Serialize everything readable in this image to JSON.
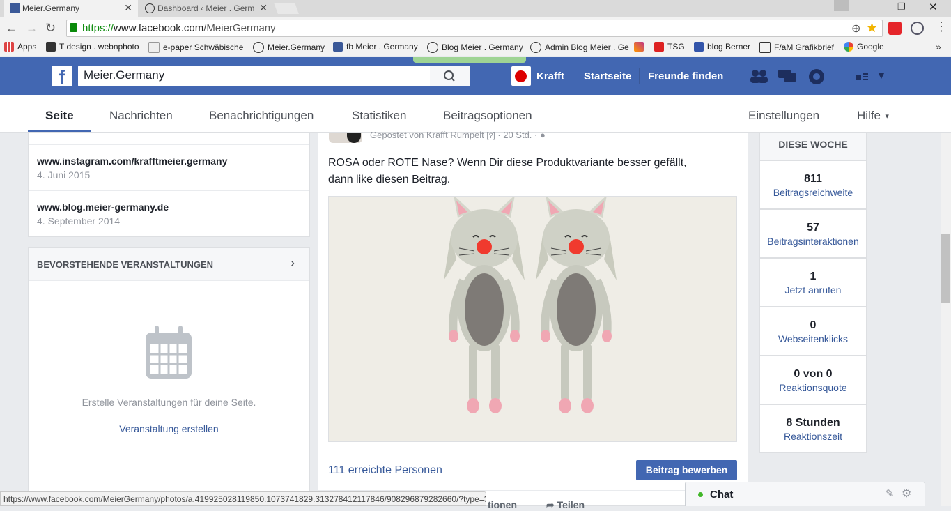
{
  "browser": {
    "tabs": [
      {
        "title": "Meier.Germany",
        "active": true
      },
      {
        "title": "Dashboard ‹ Meier . Germ",
        "active": false
      }
    ],
    "url_scheme": "https://",
    "url_host": "www.facebook.com",
    "url_path": "/MeierGermany",
    "bookmarks": [
      "Apps",
      "T design . webnphoto",
      "e-paper Schwäbische",
      "Meier.Germany",
      "fb Meier . Germany",
      "Blog Meier . Germany",
      "Admin Blog Meier . Ge",
      "TSG",
      "blog Berner",
      "F/aM Grafikbrief",
      "Google"
    ],
    "status_url": "https://www.facebook.com/MeierGermany/photos/a.419925028119850.1073741829.313278412117846/908296879282660/?type=3"
  },
  "fb": {
    "search_value": "Meier.Germany",
    "user_name": "Krafft",
    "nav_home": "Startseite",
    "nav_friends": "Freunde finden"
  },
  "page_tabs": {
    "items": [
      "Seite",
      "Nachrichten",
      "Benachrichtigungen",
      "Statistiken",
      "Beitragsoptionen"
    ],
    "settings": "Einstellungen",
    "help": "Hilfe"
  },
  "left": {
    "links": [
      {
        "url": "www.instagram.com/krafftmeier.germany",
        "date": "4. Juni 2015"
      },
      {
        "url": "www.blog.meier-germany.de",
        "date": "4. September 2014"
      }
    ],
    "events_title": "BEVORSTEHENDE VERANSTALTUNGEN",
    "events_empty": "Erstelle Veranstaltungen für deine Seite.",
    "events_create": "Veranstaltung erstellen"
  },
  "post": {
    "posted_by": "Gepostet von Krafft Rumpelt",
    "time": "20 Std.",
    "text_line1": "ROSA oder ROTE Nase? Wenn Dir diese Produktvariante besser gefällt,",
    "text_line2": "dann like diesen Beitrag.",
    "reach": "111 erreichte Personen",
    "promote": "Beitrag bewerben",
    "footer_action_1": "tionen",
    "footer_action_2": "Teilen"
  },
  "stats": {
    "header": "DIESE WOCHE",
    "items": [
      {
        "value": "811",
        "label": "Beitragsreichweite"
      },
      {
        "value": "57",
        "label": "Beitragsinteraktionen"
      },
      {
        "value": "1",
        "label": "Jetzt anrufen"
      },
      {
        "value": "0",
        "label": "Webseitenklicks"
      },
      {
        "value": "0 von 0",
        "label": "Reaktionsquote"
      },
      {
        "value": "8 Stunden",
        "label": "Reaktionszeit"
      }
    ]
  },
  "chat": {
    "label": "Chat"
  },
  "colors": {
    "fb_blue": "#4267b2",
    "link": "#365899",
    "online": "#42b72a"
  }
}
